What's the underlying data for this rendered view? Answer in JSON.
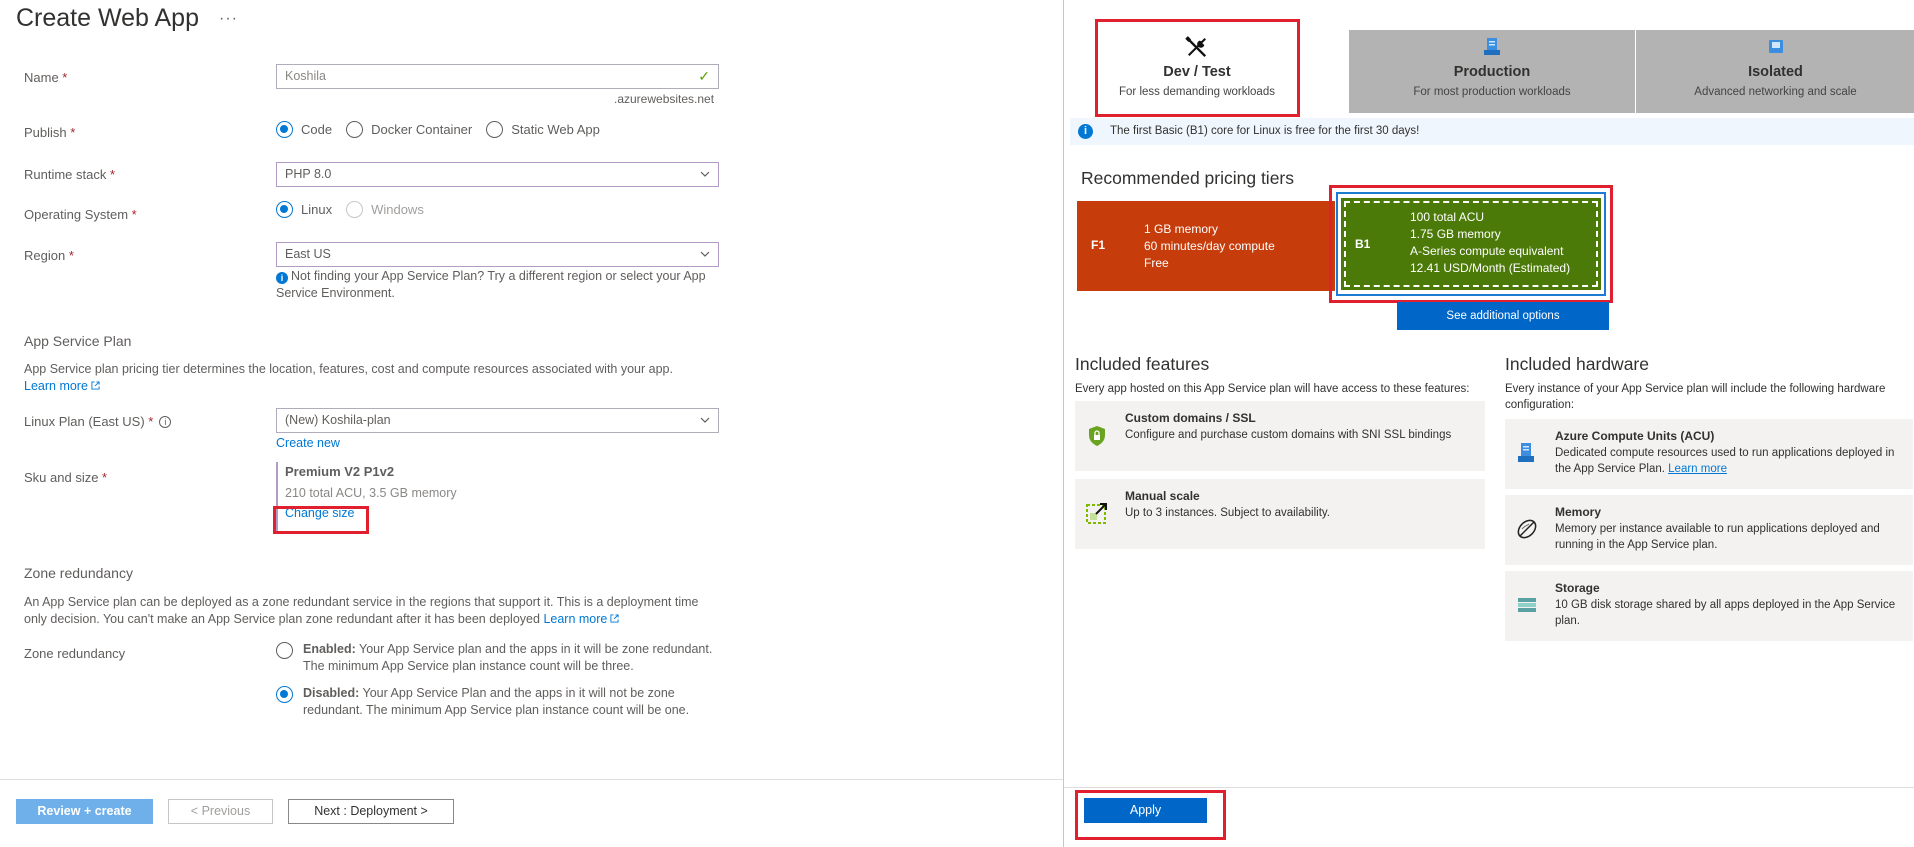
{
  "page": {
    "title": "Create Web App",
    "more": "···"
  },
  "form": {
    "name": {
      "label": "Name",
      "req": " *",
      "value": "Koshila",
      "suffix": ".azurewebsites.net"
    },
    "publish": {
      "label": "Publish",
      "req": " *",
      "options": [
        "Code",
        "Docker Container",
        "Static Web App"
      ],
      "selected": "Code"
    },
    "runtime": {
      "label": "Runtime stack",
      "req": " *",
      "value": "PHP 8.0"
    },
    "os": {
      "label": "Operating System",
      "req": " *",
      "options": [
        "Linux",
        "Windows"
      ],
      "selected": "Linux"
    },
    "region": {
      "label": "Region",
      "req": " *",
      "value": "East US",
      "hint": "Not finding your App Service Plan? Try a different region or select your App Service Environment."
    }
  },
  "plan": {
    "heading": "App Service Plan",
    "desc": "App Service plan pricing tier determines the location, features, cost and compute resources associated with your app.",
    "learn_more": "Learn more",
    "linux_plan": {
      "label": "Linux Plan (East US)",
      "req": " *",
      "value": "(New) Koshila-plan",
      "create_new": "Create new"
    },
    "sku": {
      "label": "Sku and size",
      "req": " *",
      "name": "Premium V2 P1v2",
      "detail": "210 total ACU, 3.5 GB memory",
      "change": "Change size"
    }
  },
  "zone": {
    "heading": "Zone redundancy",
    "desc": "An App Service plan can be deployed as a zone redundant service in the regions that support it. This is a deployment time only decision. You can't make an App Service plan zone redundant after it has been deployed",
    "learn_more": "Learn more",
    "label": "Zone redundancy",
    "enabled": {
      "title": "Enabled:",
      "text": " Your App Service plan and the apps in it will be zone redundant. The minimum App Service plan instance count will be three."
    },
    "disabled": {
      "title": "Disabled:",
      "text": " Your App Service Plan and the apps in it will not be zone redundant. The minimum App Service plan instance count will be one."
    },
    "selected": "Disabled"
  },
  "footer": {
    "review": "Review + create",
    "previous": "< Previous",
    "next": "Next : Deployment >"
  },
  "pricing": {
    "tabs": [
      {
        "title": "Dev / Test",
        "sub": "For less demanding workloads",
        "icon": "tools-icon",
        "active": true
      },
      {
        "title": "Production",
        "sub": "For most production workloads",
        "icon": "server-icon",
        "active": false
      },
      {
        "title": "Isolated",
        "sub": "Advanced networking and scale",
        "icon": "cube-icon",
        "active": false
      }
    ],
    "banner": "The first Basic (B1) core for Linux is free for the first 30 days!",
    "recommended_heading": "Recommended pricing tiers",
    "tiers": [
      {
        "code": "F1",
        "lines": [
          "1 GB memory",
          "60 minutes/day compute",
          "Free"
        ],
        "color": "#c63c0b"
      },
      {
        "code": "B1",
        "lines": [
          "100 total ACU",
          "1.75 GB memory",
          "A-Series compute equivalent",
          "12.41 USD/Month (Estimated)"
        ],
        "color": "#4c7a08"
      }
    ],
    "see_more": "See additional options",
    "features": {
      "heading": "Included features",
      "sub": "Every app hosted on this App Service plan will have access to these features:",
      "items": [
        {
          "title": "Custom domains / SSL",
          "desc": "Configure and purchase custom domains with SNI SSL bindings"
        },
        {
          "title": "Manual scale",
          "desc": "Up to 3 instances. Subject to availability."
        }
      ]
    },
    "hardware": {
      "heading": "Included hardware",
      "sub": "Every instance of your App Service plan will include the following hardware configuration:",
      "items": [
        {
          "title": "Azure Compute Units (ACU)",
          "desc": "Dedicated compute resources used to run applications deployed in the App Service Plan. ",
          "link": "Learn more"
        },
        {
          "title": "Memory",
          "desc": "Memory per instance available to run applications deployed and running in the App Service plan."
        },
        {
          "title": "Storage",
          "desc": "10 GB disk storage shared by all apps deployed in the App Service plan."
        }
      ]
    },
    "apply": "Apply"
  },
  "colors": {
    "accent": "#0078d4",
    "highlight": "#e0202e",
    "f1": "#c63c0b",
    "b1": "#4c7a08"
  }
}
